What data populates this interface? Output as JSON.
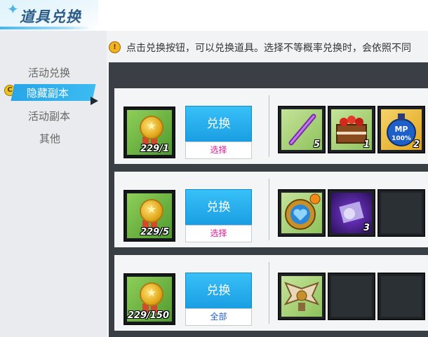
{
  "window": {
    "title": "道具兑换"
  },
  "sidebar": {
    "items": [
      {
        "label": "活动兑换",
        "active": false
      },
      {
        "label": "隐藏副本",
        "active": true
      },
      {
        "label": "活动副本",
        "active": false
      },
      {
        "label": "其他",
        "active": false
      }
    ]
  },
  "notice": {
    "text": "点击兑换按钮，可以兑换道具。选择不等概率兑换时，会依照不同"
  },
  "rows": [
    {
      "cost": {
        "icon": "gold-medal-icon",
        "count": "229/1"
      },
      "exchange_label": "兑换",
      "select_label": "选择",
      "select_color": "#e0189a",
      "rewards": [
        {
          "icon": "purple-flute-icon",
          "count": "5"
        },
        {
          "icon": "treasure-chest-icon",
          "count": "1"
        },
        {
          "icon": "mp-potion-icon",
          "count": "2"
        }
      ]
    },
    {
      "cost": {
        "icon": "gold-medal-icon",
        "count": "229/5"
      },
      "exchange_label": "兑换",
      "select_label": "选择",
      "select_color": "#e0189a",
      "rewards": [
        {
          "icon": "heart-clock-compass-icon",
          "count": ""
        },
        {
          "icon": "purple-scroll-icon",
          "count": "3"
        },
        {
          "icon": "empty-slot",
          "count": ""
        }
      ]
    },
    {
      "cost": {
        "icon": "gold-medal-icon",
        "count": "229/150"
      },
      "exchange_label": "兑换",
      "select_label": "全部",
      "select_color": "#1f5fc8",
      "rewards": [
        {
          "icon": "winged-emblem-icon",
          "count": ""
        },
        {
          "icon": "empty-slot",
          "count": ""
        },
        {
          "icon": "empty-slot",
          "count": ""
        }
      ]
    }
  ],
  "colors": {
    "accent": "#28a6e6",
    "button": "#1a9ee3",
    "panel": "#3a3f45"
  }
}
